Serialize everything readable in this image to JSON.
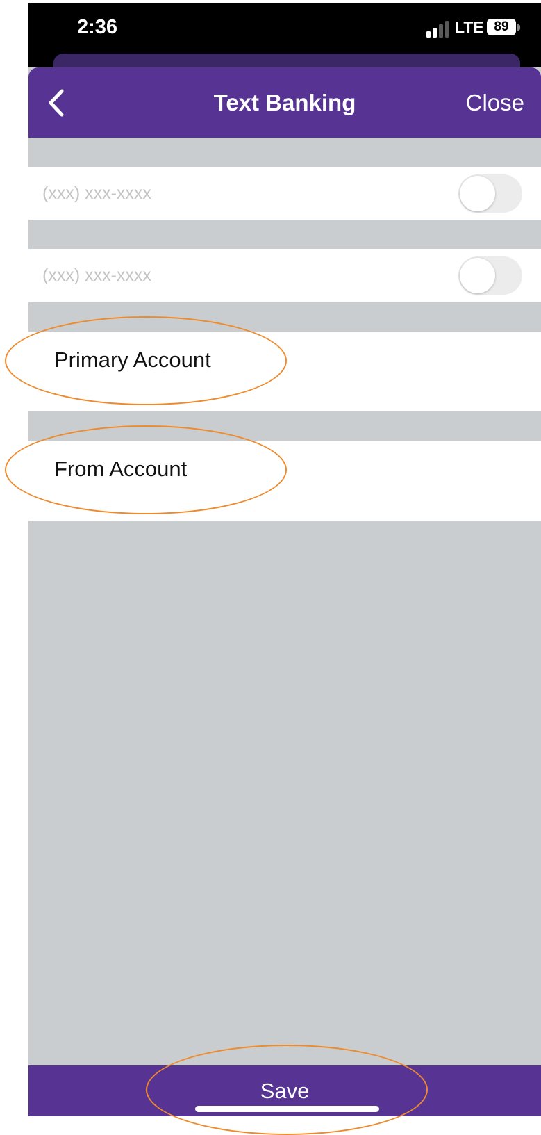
{
  "status_bar": {
    "time": "2:36",
    "network": "LTE",
    "battery": "89"
  },
  "nav": {
    "title": "Text Banking",
    "close_label": "Close",
    "back_icon": "chevron-left-icon"
  },
  "phone_rows": [
    {
      "placeholder": "(xxx) xxx-xxxx",
      "toggle_on": false
    },
    {
      "placeholder": "(xxx) xxx-xxxx",
      "toggle_on": false
    }
  ],
  "accounts": {
    "primary_label": "Primary Account",
    "from_label": "From Account"
  },
  "footer": {
    "save_label": "Save"
  },
  "colors": {
    "brand_purple": "#573493",
    "background_gray": "#c9cdcf",
    "annotation_orange": "#ef8a2b"
  }
}
